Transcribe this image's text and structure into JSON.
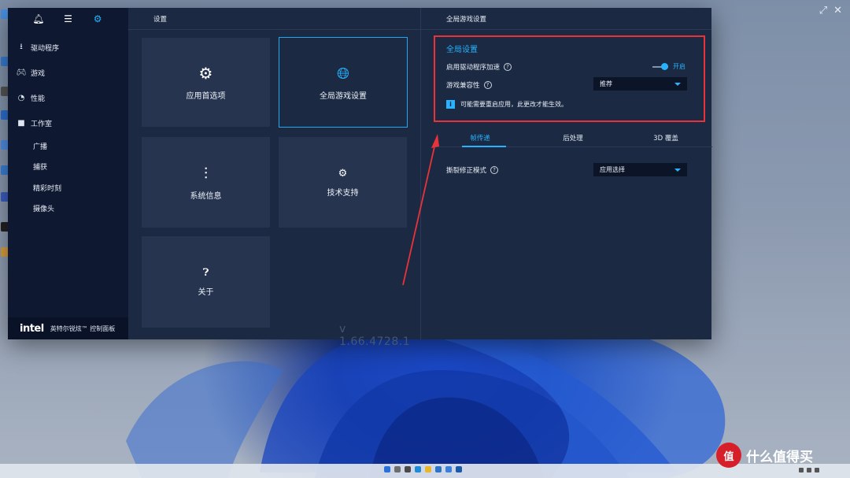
{
  "window": {
    "app_title": "英特尔锐炫™ 控制面板",
    "brand_logo": "intel",
    "version": "v 1.66.4728.1"
  },
  "sidebar": {
    "top_icons": [
      "bell-icon",
      "menu-lines-icon",
      "gear-icon"
    ],
    "items": [
      {
        "label": "驱动程序",
        "icon": "download-icon"
      },
      {
        "label": "游戏",
        "icon": "gamepad-icon"
      },
      {
        "label": "性能",
        "icon": "gauge-icon"
      },
      {
        "label": "工作室",
        "icon": "camera-icon"
      }
    ],
    "sub_items": [
      "广播",
      "捕获",
      "精彩时刻",
      "摄像头"
    ]
  },
  "settings": {
    "header": "设置",
    "tiles": [
      {
        "label": "应用首选项",
        "icon": "gear-icon"
      },
      {
        "label": "全局游戏设置",
        "icon": "globe-gear-icon"
      },
      {
        "label": "系统信息",
        "icon": "sliders-icon"
      },
      {
        "label": "技术支持",
        "icon": "gear-small-icon"
      },
      {
        "label": "关于",
        "icon": "question-icon"
      }
    ]
  },
  "global_game": {
    "header": "全局游戏设置",
    "section_title": "全局设置",
    "driver_accel_label": "启用驱动程序加速",
    "driver_accel_state": "开启",
    "compat_label": "游戏兼容性",
    "compat_value": "推荐",
    "notice": "可能需要重启应用，此更改才能生效。",
    "tabs": [
      "帧传递",
      "后处理",
      "3D 覆盖"
    ],
    "tearing_label": "撕裂修正模式",
    "tearing_value": "应用选择"
  },
  "watermark": {
    "logo": "值",
    "text": "什么值得买"
  },
  "colors": {
    "accent": "#27b3ff",
    "highlight_box": "#e8333a",
    "sidebar_bg": "#0e1830",
    "panel_bg": "#1b2942",
    "tile_bg": "#26344f"
  }
}
